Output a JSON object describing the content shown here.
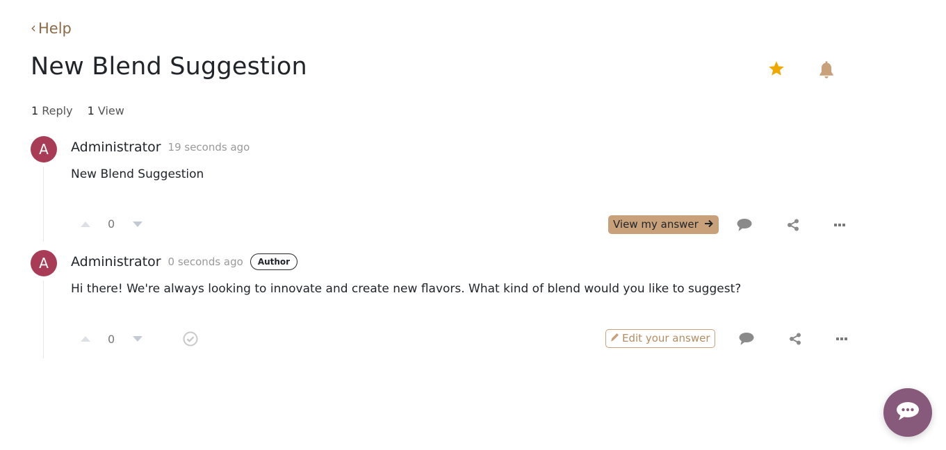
{
  "breadcrumb": {
    "back_label": "Help"
  },
  "page": {
    "title": "New Blend Suggestion"
  },
  "header_icons": {
    "favorite": "star-icon",
    "follow": "bell-icon"
  },
  "stats": {
    "replies_count": "1",
    "replies_label": "Reply",
    "views_count": "1",
    "views_label": "View"
  },
  "posts": [
    {
      "avatar_initial": "A",
      "author": "Administrator",
      "time": "19 seconds ago",
      "content": "New Blend Suggestion",
      "votes": "0",
      "action_button": "View my answer",
      "action_icon": "arrow-right-icon"
    },
    {
      "avatar_initial": "A",
      "author": "Administrator",
      "time": "0 seconds ago",
      "badge": "Author",
      "content": "Hi there! We're always looking to innovate and create new flavors. What kind of blend would you like to suggest?",
      "votes": "0",
      "action_button": "Edit your answer",
      "action_icon": "pencil-icon"
    }
  ],
  "colors": {
    "accent": "#c8a07a",
    "avatar": "#a83b55",
    "star": "#f0a800",
    "chat_button": "#875a7b"
  }
}
